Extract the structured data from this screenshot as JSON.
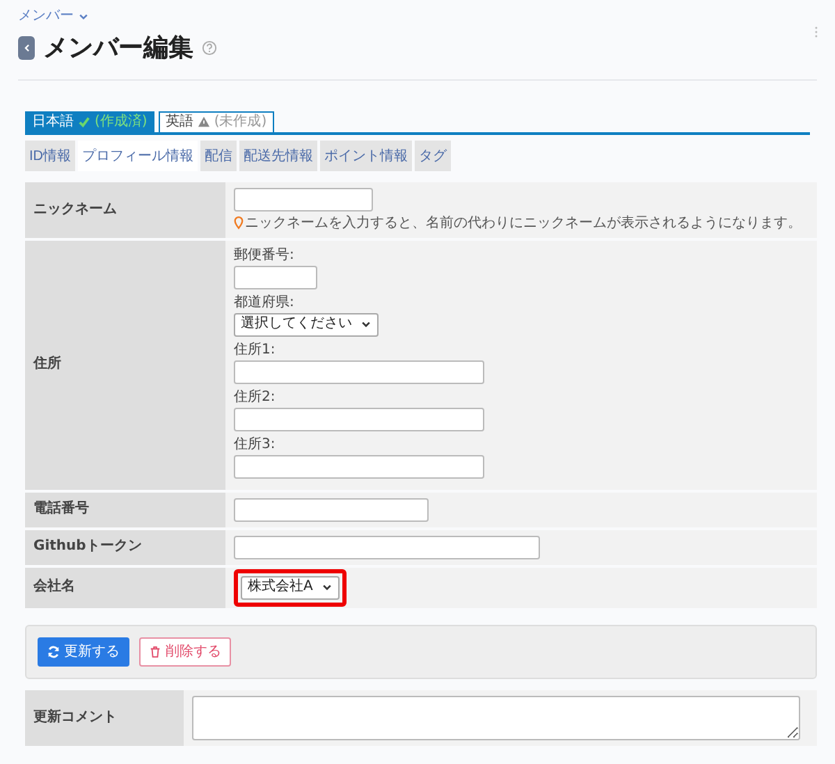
{
  "breadcrumb": {
    "label": "メンバー"
  },
  "title": "メンバー編集",
  "language_tabs": [
    {
      "label": "日本語",
      "status": "(作成済)",
      "kind": "done",
      "selected": true
    },
    {
      "label": "英語",
      "status": "(未作成)",
      "kind": "missing",
      "selected": false
    }
  ],
  "tabs": [
    {
      "label": "ID情報",
      "selected": false
    },
    {
      "label": "プロフィール情報",
      "selected": true
    },
    {
      "label": "配信",
      "selected": false
    },
    {
      "label": "配送先情報",
      "selected": false
    },
    {
      "label": "ポイント情報",
      "selected": false
    },
    {
      "label": "タグ",
      "selected": false
    }
  ],
  "form": {
    "rows": [
      {
        "label": "ニックネーム",
        "kind": "text",
        "hint": "ニックネームを入力すると、名前の代わりにニックネームが表示されるようになります。"
      },
      {
        "label": "住所",
        "kind": "address",
        "fields": [
          {
            "label": "郵便番号:",
            "kind": "text"
          },
          {
            "label": "都道府県:",
            "kind": "select",
            "value": "選択してください"
          },
          {
            "label": "住所1:",
            "kind": "text"
          },
          {
            "label": "住所2:",
            "kind": "text"
          },
          {
            "label": "住所3:",
            "kind": "text"
          }
        ]
      },
      {
        "label": "電話番号",
        "kind": "text"
      },
      {
        "label": "Githubトークン",
        "kind": "text"
      },
      {
        "label": "会社名",
        "kind": "select",
        "value": "株式会社A",
        "highlighted": true
      }
    ]
  },
  "actions": [
    {
      "label": "更新する",
      "kind": "primary"
    },
    {
      "label": "削除する",
      "kind": "danger"
    }
  ],
  "comment": {
    "label": "更新コメント"
  }
}
